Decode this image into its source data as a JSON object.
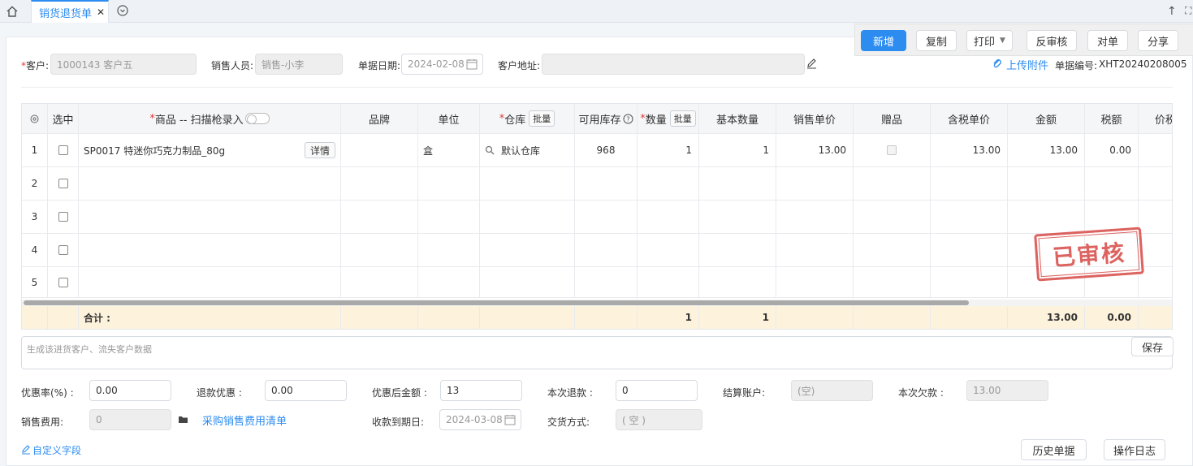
{
  "tabs": {
    "active_label": "销货退货单",
    "close_glyph": "✕"
  },
  "toolbar": {
    "new": "新增",
    "copy": "复制",
    "print": "打印",
    "unaudit": "反审核",
    "reconcile": "对单",
    "share": "分享"
  },
  "header": {
    "customer_label": "客户:",
    "customer_value": "1000143 客户五",
    "salesperson_label": "销售人员:",
    "salesperson_value": "销售-小李",
    "date_label": "单据日期:",
    "date_value": "2024-02-08",
    "address_label": "客户地址:",
    "address_value": "",
    "upload_label": "上传附件",
    "doc_no_label": "单据编号:",
    "doc_no_value": "XHT20240208005"
  },
  "grid": {
    "columns": {
      "select": "选中",
      "product": "商品 -- 扫描枪录入",
      "brand": "品牌",
      "unit": "单位",
      "warehouse": "仓库",
      "stock": "可用库存",
      "qty": "数量",
      "base_qty": "基本数量",
      "price": "销售单价",
      "gift": "赠品",
      "tax_price": "含税单价",
      "amount": "金额",
      "tax": "税额",
      "price_tax": "价税"
    },
    "batch_label": "批量",
    "detail_label": "详情",
    "rows": [
      {
        "no": "1",
        "product": "SP0017 特迷你巧克力制品_80g",
        "unit": "盒",
        "warehouse": "默认仓库",
        "stock": "968",
        "qty": "1",
        "base_qty": "1",
        "price": "13.00",
        "tax_price": "13.00",
        "amount": "13.00",
        "tax": "0.00"
      },
      {
        "no": "2"
      },
      {
        "no": "3"
      },
      {
        "no": "4"
      },
      {
        "no": "5"
      }
    ],
    "total": {
      "label": "合计 :",
      "qty": "1",
      "base_qty": "1",
      "amount": "13.00",
      "tax": "0.00"
    }
  },
  "stamp_text": "已审核",
  "memo_placeholder": "生成该进货客户、流失客户数据",
  "save_label": "保存",
  "footer": {
    "discount_rate_label": "优惠率(%) :",
    "discount_rate": "0.00",
    "refund_discount_label": "退款优惠 :",
    "refund_discount": "0.00",
    "after_discount_label": "优惠后金额 :",
    "after_discount": "13",
    "this_refund_label": "本次退款 :",
    "this_refund": "0",
    "account_label": "结算账户:",
    "account_value": "(空)",
    "this_owe_label": "本次欠款 :",
    "this_owe": "13.00",
    "sales_fee_label": "销售费用:",
    "sales_fee": "0",
    "fee_list_link": "采购销售费用清单",
    "due_date_label": "收款到期日:",
    "due_date": "2024-03-08",
    "delivery_label": "交货方式:",
    "delivery_value": "( 空 )",
    "custom_field_link": "自定义字段",
    "history_btn": "历史单据",
    "log_btn": "操作日志"
  }
}
